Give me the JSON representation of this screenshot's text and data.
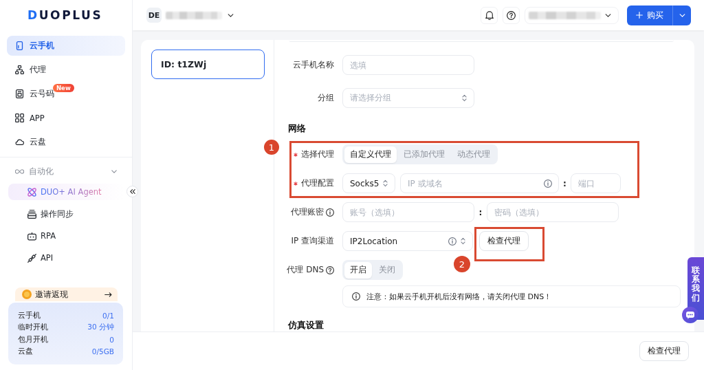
{
  "sidebar": {
    "logo": "DUOPLUS",
    "nav": [
      {
        "label": "云手机",
        "selected": true
      },
      {
        "label": "代理",
        "selected": false
      },
      {
        "label": "云号码",
        "badge": "New",
        "selected": false
      },
      {
        "label": "APP",
        "selected": false
      },
      {
        "label": "云盘",
        "selected": false
      }
    ],
    "section": {
      "label": "自动化",
      "expanded": true,
      "items": [
        {
          "label": "DUO+ AI Agent",
          "highlighted": true
        },
        {
          "label": "操作同步",
          "highlighted": false
        },
        {
          "label": "RPA",
          "highlighted": false
        },
        {
          "label": "API",
          "highlighted": false
        }
      ]
    },
    "invite": {
      "label": "邀请返现"
    },
    "stats": [
      {
        "label": "云手机",
        "value": "0/1"
      },
      {
        "label": "临时开机",
        "value": "30 分钟"
      },
      {
        "label": "包月开机",
        "value": "0"
      },
      {
        "label": "云盘",
        "value": "0/5GB"
      }
    ]
  },
  "header": {
    "workspace_initials": "DE",
    "buy_button": "购买"
  },
  "device_list": [
    {
      "label": "ID: t1ZWj",
      "selected": true
    }
  ],
  "form": {
    "rows": [
      {
        "label": "云手机名称",
        "kind": "input",
        "placeholder": "选填"
      },
      {
        "label": "分组",
        "kind": "select",
        "placeholder": "请选择分组"
      }
    ],
    "sections": [
      {
        "title": "网络",
        "rows": [
          {
            "label": "选择代理",
            "required": true,
            "kind": "segmented",
            "options": [
              {
                "label": "自定义代理",
                "selected": true
              },
              {
                "label": "已添加代理",
                "selected": false
              },
              {
                "label": "动态代理",
                "selected": false
              }
            ]
          },
          {
            "label": "代理配置",
            "required": true,
            "kind": "proxy",
            "protocol": "Socks5",
            "host_placeholder": "IP 或域名",
            "separator": ":",
            "port_placeholder": "端口"
          },
          {
            "label": "代理账密",
            "required": false,
            "tip": {
              "kind": "info"
            },
            "kind": "pair",
            "first_placeholder": "账号（选填）",
            "separator": ":",
            "second_placeholder": "密码（选填）"
          },
          {
            "label": "IP 查询渠道",
            "required": false,
            "kind": "lookup",
            "value": "IP2Location",
            "button": "检查代理"
          },
          {
            "label": "代理 DNS",
            "required": false,
            "tip": {
              "kind": "help"
            },
            "kind": "segmented",
            "options": [
              {
                "label": "开启",
                "selected": true
              },
              {
                "label": "关闭",
                "selected": false
              }
            ]
          },
          {
            "kind": "notice",
            "text": "注意：如果云手机开机后没有网络，请关闭代理 DNS！"
          }
        ]
      },
      {
        "title": "仿真设置"
      }
    ]
  },
  "annotations": [
    {
      "number": "1"
    },
    {
      "number": "2"
    }
  ],
  "footer": {
    "button": "检查代理"
  },
  "contact_tab": {
    "label": "联系我们"
  }
}
